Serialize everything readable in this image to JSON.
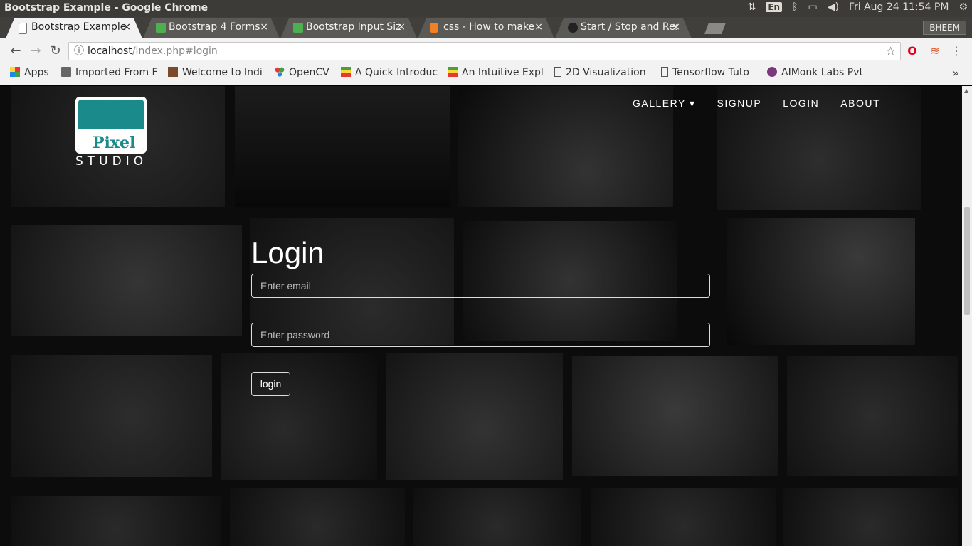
{
  "window": {
    "title": "Bootstrap Example - Google Chrome"
  },
  "system_tray": {
    "lang": "En",
    "datetime": "Fri Aug 24 11:54 PM"
  },
  "tabs": [
    {
      "label": "Bootstrap Example",
      "active": true,
      "icon": "page-icon",
      "icon_color": "#888888"
    },
    {
      "label": "Bootstrap 4 Forms",
      "active": false,
      "icon": "w3schools-icon",
      "icon_color": "#4caf50"
    },
    {
      "label": "Bootstrap Input Siz",
      "active": false,
      "icon": "w3schools-icon",
      "icon_color": "#4caf50"
    },
    {
      "label": "css - How to make a",
      "active": false,
      "icon": "stackoverflow-icon",
      "icon_color": "#f48024"
    },
    {
      "label": "Start / Stop and Res",
      "active": false,
      "icon": "github-icon",
      "icon_color": "#333333"
    }
  ],
  "profile": {
    "name": "BHEEM"
  },
  "toolbar": {
    "url_host": "localhost",
    "url_path": "/index.php#login"
  },
  "bookmarks": [
    {
      "label": "Apps",
      "icon": "apps-grid-icon"
    },
    {
      "label": "Imported From F",
      "icon": "folder-icon"
    },
    {
      "label": "Welcome to Indi",
      "icon": "site-icon"
    },
    {
      "label": "OpenCV",
      "icon": "opencv-icon"
    },
    {
      "label": "A Quick Introduc",
      "icon": "site-icon"
    },
    {
      "label": "An Intuitive Expl",
      "icon": "site-icon"
    },
    {
      "label": "2D Visualization",
      "icon": "page-icon"
    },
    {
      "label": "Tensorflow Tuto",
      "icon": "page-icon"
    },
    {
      "label": "AIMonk Labs Pvt",
      "icon": "aimonk-icon"
    }
  ],
  "page": {
    "logo": {
      "brand": "Pixel",
      "sub": "STUDIO"
    },
    "nav": [
      {
        "label": "GALLERY ▾"
      },
      {
        "label": "SIGNUP"
      },
      {
        "label": "LOGIN"
      },
      {
        "label": "ABOUT"
      }
    ],
    "login": {
      "title": "Login",
      "email_placeholder": "Enter email",
      "password_placeholder": "Enter password",
      "button": "login"
    }
  },
  "colors": {
    "accent_teal": "#1a8a8a"
  }
}
